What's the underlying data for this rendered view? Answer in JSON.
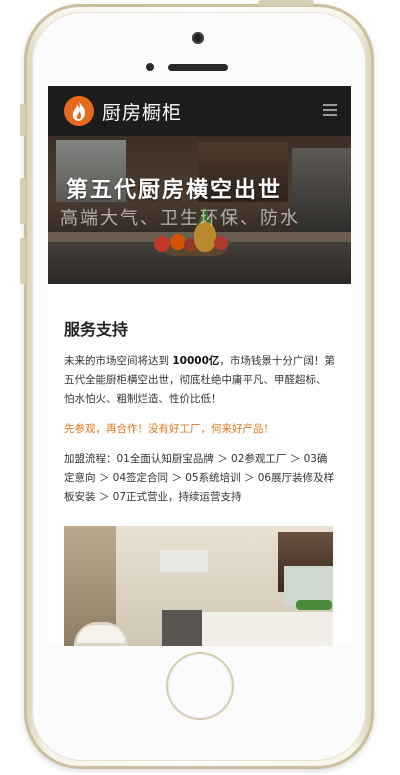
{
  "header": {
    "logo_icon": "flame-icon",
    "title": "厨房橱柜",
    "menu_icon": "hamburger-menu-icon"
  },
  "banner": {
    "title": "第五代厨房横空出世",
    "subtitle": "高端大气、卫生环保、防水"
  },
  "service": {
    "title": "服务支持",
    "para_part1": "未来的市场空间将达到 ",
    "para_bold": "10000亿",
    "para_part2": "，市场钱景十分广阔！第五代全能厨柜横空出世，彻底杜绝中庸平凡、甲醛超标、怕水怕火、粗制烂造、性价比低！",
    "highlight": "先参观，再合作！没有好工厂，何来好产品！",
    "process": "加盟流程：01全面认知厨宝品牌 ＞ 02参观工厂 ＞ 03确定意向 ＞ 04签定合同 ＞ 05系统培训 ＞ 06展厅装修及样板安装 ＞ 07正式营业，持续运营支持"
  },
  "colors": {
    "header_bg": "#1c1c1c",
    "accent_orange": "#e0781c",
    "logo_orange": "#e66a1c"
  }
}
